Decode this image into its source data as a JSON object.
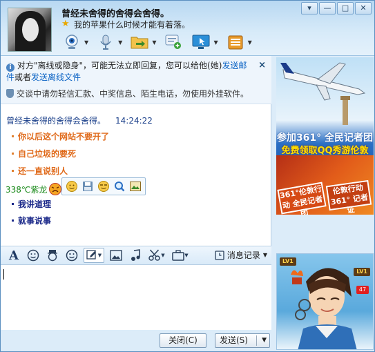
{
  "header": {
    "title": "曾经未舍得的舍得会舍得。",
    "status_text": "我的苹果什么时候才能有着落。",
    "window_buttons": {
      "menu": "▾",
      "minimize": "—",
      "maximize": "□",
      "close": "✕"
    }
  },
  "toolbar": {
    "items": [
      "video-call",
      "voice-call",
      "send-file",
      "create-discussion",
      "remote-assist",
      "app-box"
    ]
  },
  "notice": {
    "line1_prefix": "对方\"离线或隐身\"，可能无法立即回复，您可以给他(她)",
    "link1": "发送邮件",
    "line1_middle": "或者",
    "link2": "发送离线文件",
    "line2": "交谈中请勿轻信汇款、中奖信息、陌生电话，勿使用外挂软件。",
    "close": "×"
  },
  "chat": {
    "sender": "曾经未舍得的舍得会舍得。",
    "time": "14:24:22",
    "orange_lines": [
      "你以后这个网站不要开了",
      "自己垃圾的要死",
      "还一直说别人"
    ],
    "user_name": "338℃紫龙",
    "navy_lines": [
      "我讲道理",
      "就事说事"
    ]
  },
  "input_toolbar": {
    "history_label": "消息记录"
  },
  "bottom": {
    "close_label": "关闭(C)",
    "send_label": "发送(S)"
  },
  "ad": {
    "line1": "参加361° 全民记者团",
    "line2": "免费领取QQ秀游伦敦",
    "banner1": "361°伦敦行动 全民记者团",
    "banner2": "伦敦行动 361° 记者证"
  },
  "profile": {
    "level_left": "LV1",
    "level_right": "LV1",
    "badge": "47"
  },
  "colors": {
    "accent": "#0b63c4",
    "message_orange": "#e06b1c",
    "message_navy": "#1c2a8a",
    "user_green": "#1a8a1a"
  }
}
